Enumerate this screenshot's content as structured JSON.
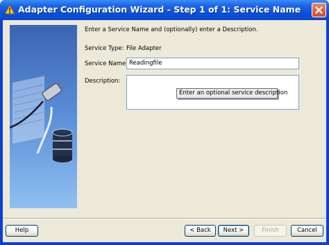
{
  "window": {
    "title": "Adapter Configuration Wizard - Step 1 of 1: Service Name"
  },
  "main": {
    "intro": "Enter a Service Name and (optionally) enter a Description.",
    "service_type_label": "Service Type:",
    "service_type_value": "File Adapter",
    "service_name_label": "Service Name:",
    "service_name_value": "Readingfile",
    "description_label": "Description:",
    "description_value": "",
    "description_tooltip": "Enter an optional service description"
  },
  "buttons": {
    "help": "Help",
    "back": "< Back",
    "next": "Next >",
    "finish": "Finish",
    "cancel": "Cancel"
  },
  "icons": {
    "title": "app-icon",
    "close": "close-icon",
    "side": "adapter-plug-database-illustration"
  },
  "colors": {
    "titlebar": "#0a4fd8",
    "dialog_bg": "#ece9d8",
    "close_button": "#d44a2a"
  }
}
